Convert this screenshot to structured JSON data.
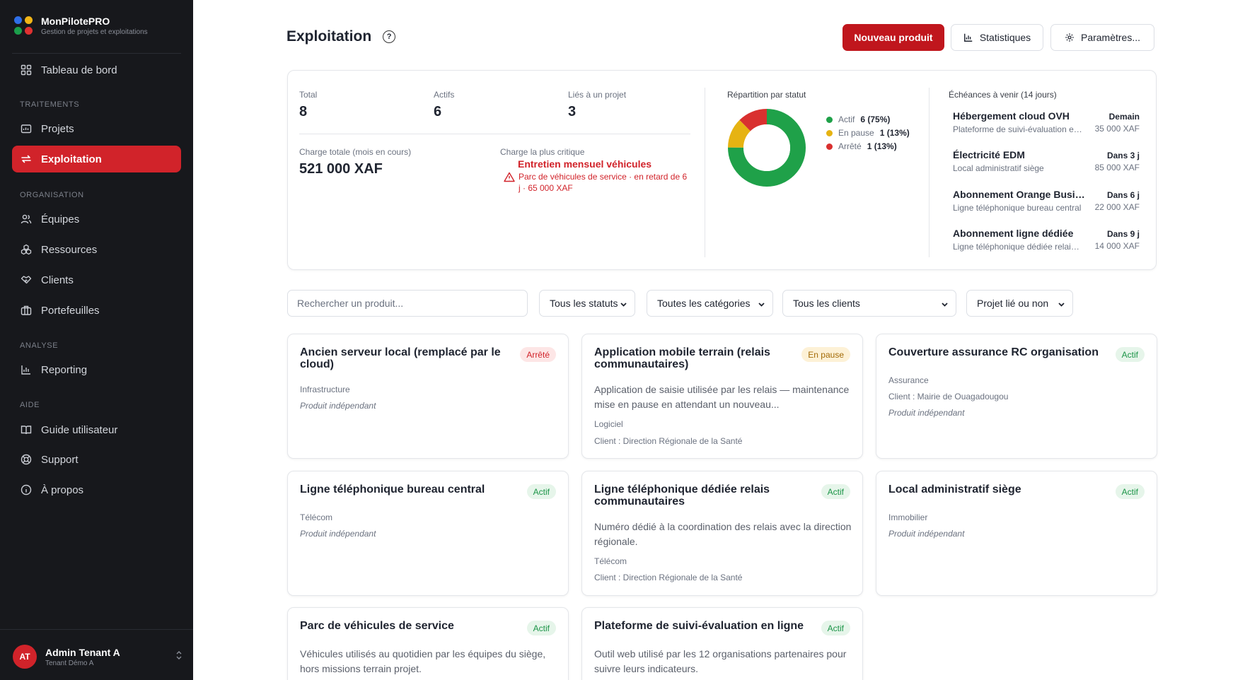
{
  "brand": {
    "name": "MonPilotePRO",
    "subtitle": "Gestion de projets et exploitations",
    "dot_colors": [
      "#2f6fe8",
      "#f2b517",
      "#1b9e4b",
      "#e03131"
    ]
  },
  "nav": {
    "dashboard": "Tableau de bord",
    "section_traitements": "TRAITEMENTS",
    "projets": "Projets",
    "exploitation": "Exploitation",
    "section_organisation": "ORGANISATION",
    "equipes": "Équipes",
    "ressources": "Ressources",
    "clients": "Clients",
    "portefeuilles": "Portefeuilles",
    "section_analyse": "ANALYSE",
    "reporting": "Reporting",
    "section_aide": "AIDE",
    "guide": "Guide utilisateur",
    "support": "Support",
    "apropos": "À propos"
  },
  "user": {
    "initials": "AT",
    "name": "Admin Tenant A",
    "tenant": "Tenant Démo A"
  },
  "header": {
    "title": "Exploitation",
    "new_product": "Nouveau produit",
    "stats": "Statistiques",
    "settings": "Paramètres..."
  },
  "stats": {
    "total_label": "Total",
    "total_value": "8",
    "actifs_label": "Actifs",
    "actifs_value": "6",
    "lies_label": "Liés à un projet",
    "lies_value": "3",
    "charge_label": "Charge totale (mois en cours)",
    "charge_value": "521 000 XAF",
    "critique_label": "Charge la plus critique",
    "critique_title": "Entretien mensuel véhicules",
    "critique_desc": "Parc de véhicules de service · en retard de 6 j · 65 000 XAF"
  },
  "repartition": {
    "title": "Répartition par statut",
    "items": [
      {
        "label": "Actif",
        "value": "6 (75%)",
        "color": "#1fa149"
      },
      {
        "label": "En pause",
        "value": "1 (13%)",
        "color": "#e6b312"
      },
      {
        "label": "Arrêté",
        "value": "1 (13%)",
        "color": "#d9302f"
      }
    ]
  },
  "echeances": {
    "title": "Échéances à venir (14 jours)",
    "items": [
      {
        "name": "Hébergement cloud OVH",
        "sub": "Plateforme de suivi-évaluation en ligne",
        "when": "Demain",
        "amount": "35 000 XAF"
      },
      {
        "name": "Électricité EDM",
        "sub": "Local administratif siège",
        "when": "Dans 3 j",
        "amount": "85 000 XAF"
      },
      {
        "name": "Abonnement Orange Business",
        "sub": "Ligne téléphonique bureau central",
        "when": "Dans 6 j",
        "amount": "22 000 XAF"
      },
      {
        "name": "Abonnement ligne dédiée",
        "sub": "Ligne téléphonique dédiée relais communautaires",
        "when": "Dans 9 j",
        "amount": "14 000 XAF"
      }
    ]
  },
  "filters": {
    "search_placeholder": "Rechercher un produit...",
    "status": "Tous les statuts",
    "category": "Toutes les catégories",
    "client": "Tous les clients",
    "projet": "Projet lié ou non"
  },
  "cards": [
    {
      "title": "Ancien serveur local (remplacé par le cloud)",
      "status": "Arrêté",
      "category": "Infrastructure",
      "independent": "Produit indépendant"
    },
    {
      "title": "Application mobile terrain (relais communautaires)",
      "status": "En pause",
      "description": "Application de saisie utilisée par les relais — maintenance mise en pause en attendant un nouveau...",
      "category": "Logiciel",
      "client": "Client : Direction Régionale de la Santé"
    },
    {
      "title": "Couverture assurance RC organisation",
      "status": "Actif",
      "category": "Assurance",
      "client": "Client : Mairie de Ouagadougou",
      "independent": "Produit indépendant"
    },
    {
      "title": "Ligne téléphonique bureau central",
      "status": "Actif",
      "category": "Télécom",
      "independent": "Produit indépendant"
    },
    {
      "title": "Ligne téléphonique dédiée relais communautaires",
      "status": "Actif",
      "description": "Numéro dédié à la coordination des relais avec la direction régionale.",
      "category": "Télécom",
      "client": "Client : Direction Régionale de la Santé"
    },
    {
      "title": "Local administratif siège",
      "status": "Actif",
      "category": "Immobilier",
      "independent": "Produit indépendant"
    },
    {
      "title": "Parc de véhicules de service",
      "status": "Actif",
      "description": "Véhicules utilisés au quotidien par les équipes du siège, hors missions terrain projet."
    },
    {
      "title": "Plateforme de suivi-évaluation en ligne",
      "status": "Actif",
      "description": "Outil web utilisé par les 12 organisations partenaires pour suivre leurs indicateurs."
    }
  ]
}
